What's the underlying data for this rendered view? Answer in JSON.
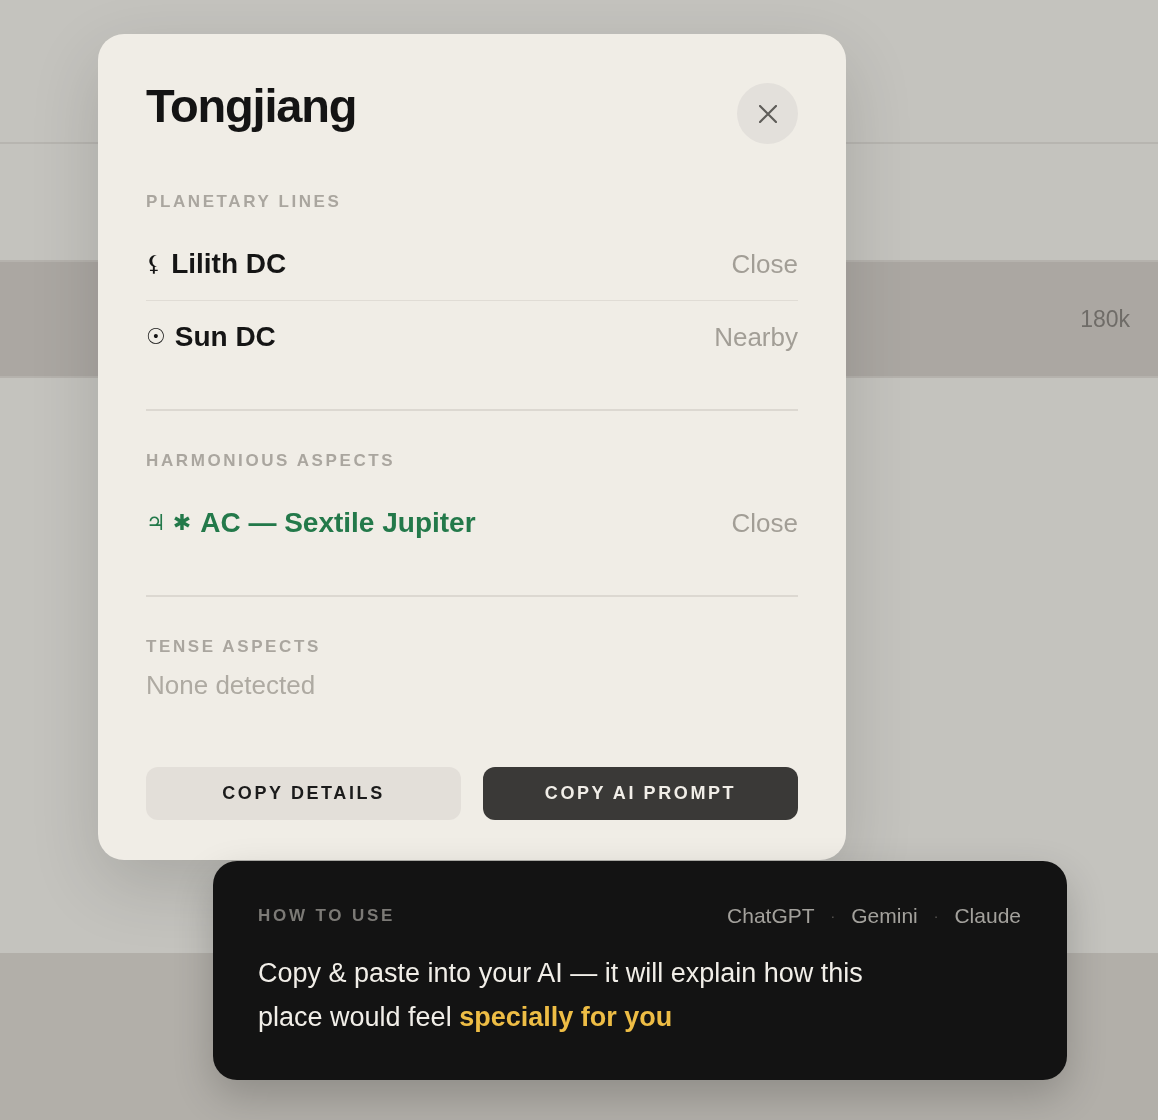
{
  "background": {
    "row_value": "180k"
  },
  "modal": {
    "title": "Tongjiang",
    "sections": [
      {
        "kind": "planetary",
        "heading": "PLANETARY LINES",
        "items": [
          {
            "symbol": "⚸",
            "label": "Lilith DC",
            "proximity": "Close"
          },
          {
            "symbol": "☉",
            "label": "Sun DC",
            "proximity": "Nearby"
          }
        ]
      },
      {
        "kind": "harmonious",
        "heading": "HARMONIOUS ASPECTS",
        "items": [
          {
            "symbol": "♃ ✱",
            "label": "AC — Sextile Jupiter",
            "proximity": "Close"
          }
        ]
      },
      {
        "kind": "tense",
        "heading": "TENSE ASPECTS",
        "empty_text": "None detected"
      }
    ],
    "buttons": [
      {
        "label": "COPY DETAILS",
        "kind": "secondary"
      },
      {
        "label": "COPY AI PROMPT",
        "kind": "primary"
      }
    ]
  },
  "tooltip": {
    "heading": "HOW TO USE",
    "ai_names": [
      {
        "name": "ChatGPT",
        "separator": "·"
      },
      {
        "name": "Gemini",
        "separator": "·"
      },
      {
        "name": "Claude"
      }
    ],
    "message": "Copy & paste into your AI — it will explain how this place would feel **specially for you**"
  }
}
